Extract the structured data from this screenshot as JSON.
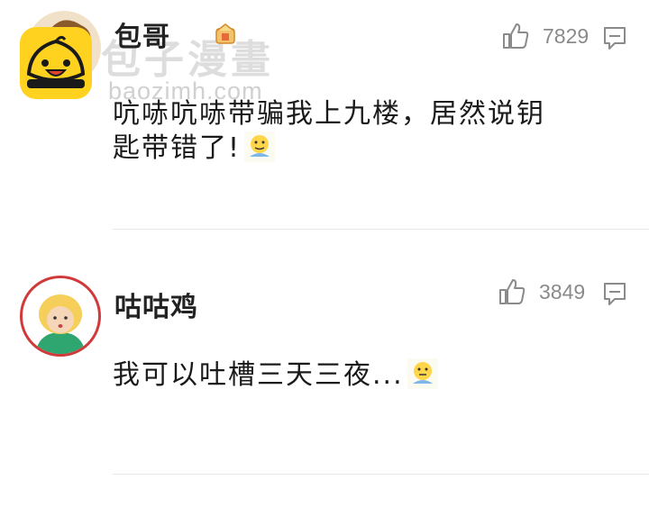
{
  "watermark": {
    "title": "包子漫畫",
    "url": "baozimh.com"
  },
  "comments": [
    {
      "username": "包哥",
      "likes": "7829",
      "text_line1": "吭哧吭哧带骗我上九楼，居然说钥",
      "text_line2": "匙带错了!",
      "emoji": "emoji-face-icon"
    },
    {
      "username": "咕咕鸡",
      "likes": "3849",
      "text": "我可以吐槽三天三夜...",
      "emoji": "emoji-face-icon"
    }
  ],
  "colors": {
    "username": "#222222",
    "count": "#8a8a8a",
    "divider": "#e6e6e6",
    "logo": "#ffd21f"
  }
}
